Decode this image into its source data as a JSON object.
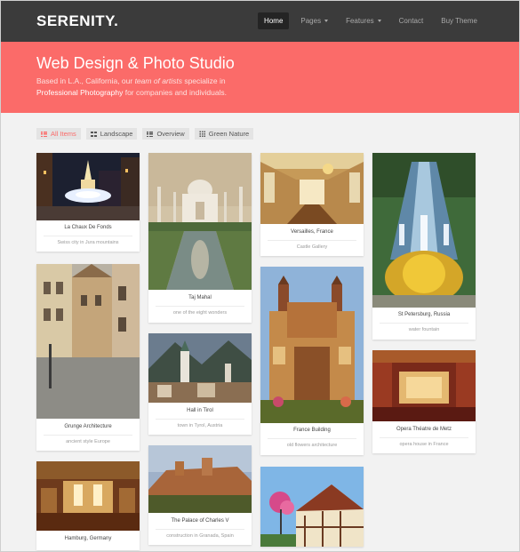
{
  "brand": "SERENITY.",
  "nav": {
    "home": "Home",
    "pages": "Pages",
    "features": "Features",
    "contact": "Contact",
    "buy": "Buy Theme"
  },
  "hero": {
    "title": "Web Design & Photo Studio",
    "sub_1": "Based in L.A., California, our ",
    "sub_em": "team of artists",
    "sub_2": " specialize in",
    "sub_strong": "Professional Photography",
    "sub_3": " for companies and individuals."
  },
  "filters": {
    "all": "All Items",
    "landscape": "Landscape",
    "overview": "Overview",
    "green": "Green Nature"
  },
  "cards": [
    {
      "title": "La Chaux De Fonds",
      "desc": "Swiss city in Jura mountains"
    },
    {
      "title": "Grunge Architecture",
      "desc": "ancient style Europe"
    },
    {
      "title": "Hamburg, Germany",
      "desc": ""
    },
    {
      "title": "Taj Mahal",
      "desc": "one of the eight wonders"
    },
    {
      "title": "Hall in Tirol",
      "desc": "town in Tyrol, Austria"
    },
    {
      "title": "The Palace of Charles V",
      "desc": "construction in Granada, Spain"
    },
    {
      "title": "Versailles, France",
      "desc": "Castle Gallery"
    },
    {
      "title": "France Building",
      "desc": "old flowers architecture"
    },
    {
      "title": "St Petersburg, Russia",
      "desc": "water fountain"
    },
    {
      "title": "Opera Théatre de Metz",
      "desc": "opera house in France"
    }
  ],
  "colors": {
    "accent": "#fb6b69",
    "nav_bg": "#3b3b3b"
  }
}
